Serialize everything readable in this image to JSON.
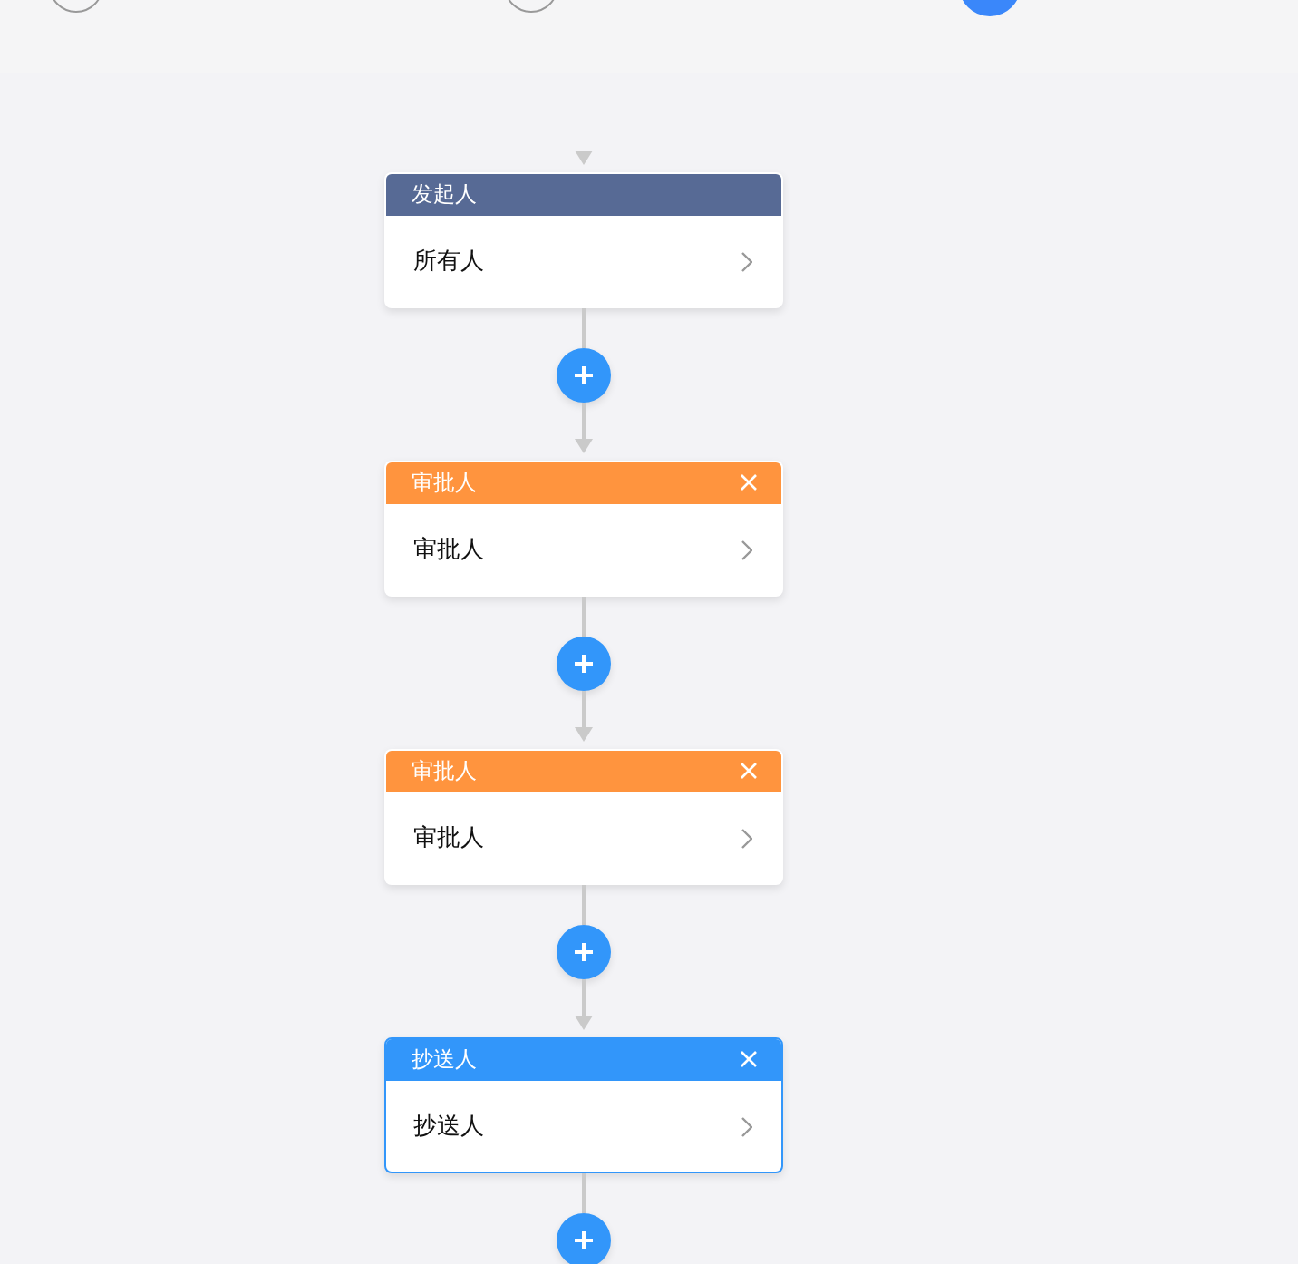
{
  "steps": [
    {
      "selected": false
    },
    {
      "selected": false
    },
    {
      "selected": true
    }
  ],
  "nodes": [
    {
      "kind": "starter",
      "title": "发起人",
      "content": "所有人",
      "selected": false
    },
    {
      "kind": "approver",
      "title": "审批人",
      "content": "审批人",
      "selected": false
    },
    {
      "kind": "approver",
      "title": "审批人",
      "content": "审批人",
      "selected": false
    },
    {
      "kind": "cc",
      "title": "抄送人",
      "content": "抄送人",
      "selected": true
    }
  ]
}
